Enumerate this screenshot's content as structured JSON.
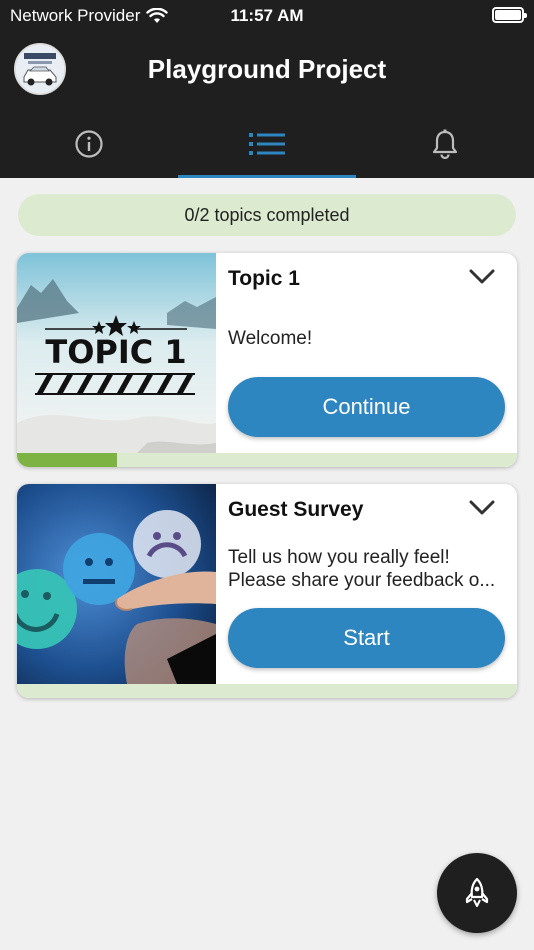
{
  "status_bar": {
    "carrier": "Network Provider",
    "time": "11:57 AM"
  },
  "header": {
    "title": "Playground Project",
    "avatar_icon": "car-logo-avatar"
  },
  "tabs": [
    {
      "icon": "info-icon",
      "active": false
    },
    {
      "icon": "list-icon",
      "active": true
    },
    {
      "icon": "bell-icon",
      "active": false
    }
  ],
  "progress": {
    "label": "0/2 topics completed",
    "completed": 0,
    "total": 2
  },
  "cards": [
    {
      "title": "Topic 1",
      "thumb_text": "TOPIC 1",
      "description_lines": [
        "Welcome!"
      ],
      "button_label": "Continue",
      "progress_fraction": 0.2
    },
    {
      "title": "Guest Survey",
      "thumb_icon": "smiley-feedback-image",
      "description_lines": [
        "Tell us how you really feel!",
        "Please share your feedback o..."
      ],
      "button_label": "Start",
      "progress_fraction": 0
    }
  ],
  "fab": {
    "icon": "rocket-icon"
  },
  "colors": {
    "dark": "#1f1f1f",
    "accent": "#2e86c1",
    "progress_bg": "#dcebd0",
    "progress_fill": "#7cb342"
  }
}
